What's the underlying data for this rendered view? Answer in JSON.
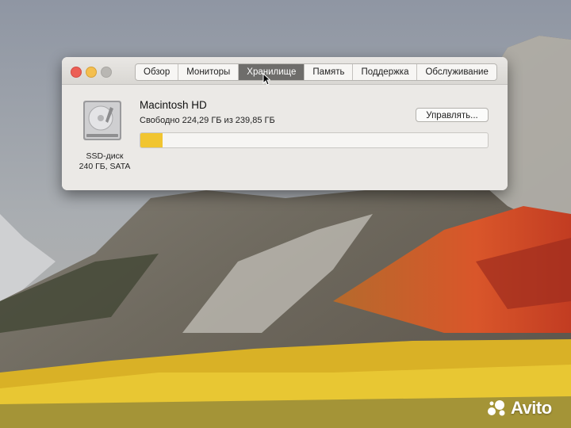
{
  "window": {
    "tabs": [
      {
        "label": "Обзор",
        "active": false
      },
      {
        "label": "Мониторы",
        "active": false
      },
      {
        "label": "Хранилище",
        "active": true
      },
      {
        "label": "Память",
        "active": false
      },
      {
        "label": "Поддержка",
        "active": false
      },
      {
        "label": "Обслуживание",
        "active": false
      }
    ]
  },
  "storage": {
    "volume_name": "Macintosh HD",
    "free_text": "Свободно 224,29 ГБ из 239,85 ГБ",
    "used_fraction": 0.065,
    "used_color": "#f1c530",
    "disk_type_line1": "SSD-диск",
    "disk_type_line2": "240 ГБ, SATA",
    "disk_icon": "hard-drive-icon",
    "manage_label": "Управлять..."
  },
  "watermark": {
    "text": "Avito",
    "icon": "avito-logo-icon"
  }
}
